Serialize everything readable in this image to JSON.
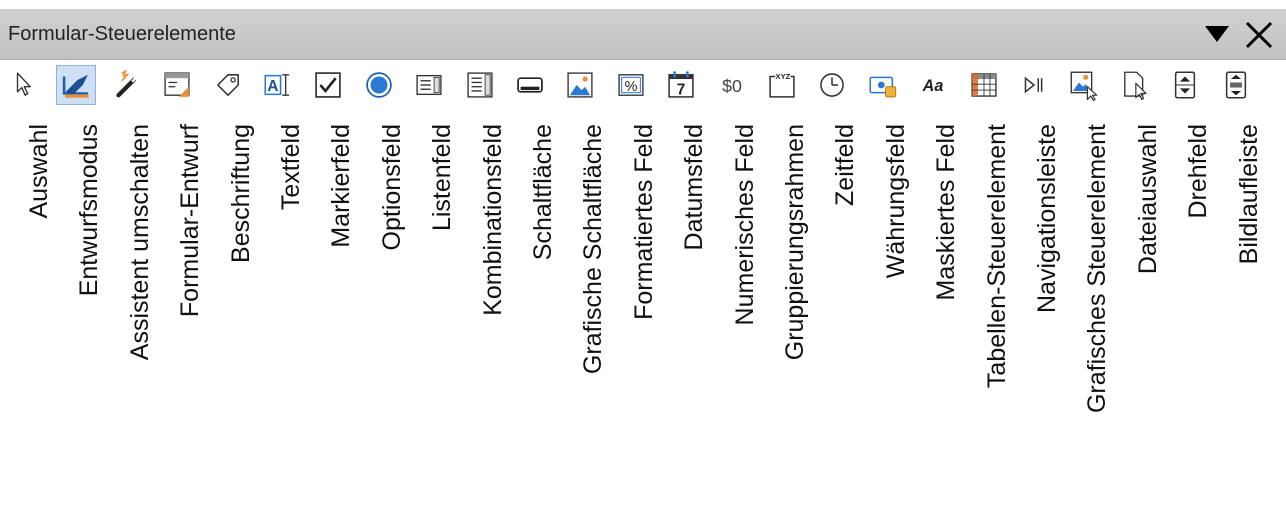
{
  "window": {
    "title": "Formular-Steuerelemente"
  },
  "controls": [
    {
      "id": "auswahl",
      "label": "Auswahl",
      "icon": "pointer-icon"
    },
    {
      "id": "entwurfsmodus",
      "label": "Entwurfsmodus",
      "icon": "design-mode-icon",
      "active": true
    },
    {
      "id": "assistent",
      "label": "Assistent umschalten",
      "icon": "wizard-icon"
    },
    {
      "id": "formular-entwurf",
      "label": "Formular-Entwurf",
      "icon": "form-design-icon"
    },
    {
      "id": "beschriftung",
      "label": "Beschriftung",
      "icon": "label-tag-icon"
    },
    {
      "id": "textfeld",
      "label": "Textfeld",
      "icon": "text-box-icon",
      "icon_text": "A"
    },
    {
      "id": "markierfeld",
      "label": "Markierfeld",
      "icon": "checkbox-icon"
    },
    {
      "id": "optionsfeld",
      "label": "Optionsfeld",
      "icon": "option-button-icon"
    },
    {
      "id": "listenfeld",
      "label": "Listenfeld",
      "icon": "list-box-icon"
    },
    {
      "id": "kombinationsfeld",
      "label": "Kombinationsfeld",
      "icon": "combo-box-icon"
    },
    {
      "id": "schaltflaeche",
      "label": "Schaltfläche",
      "icon": "push-button-icon"
    },
    {
      "id": "grafische-schaltflaeche",
      "label": "Grafische Schaltfläche",
      "icon": "image-button-icon"
    },
    {
      "id": "formatiertes-feld",
      "label": "Formatiertes Feld",
      "icon": "formatted-field-icon",
      "icon_text": "%"
    },
    {
      "id": "datumsfeld",
      "label": "Datumsfeld",
      "icon": "date-field-icon",
      "icon_text": "7"
    },
    {
      "id": "numerisches-feld",
      "label": "Numerisches Feld",
      "icon": "numeric-field-icon",
      "icon_text": "$0"
    },
    {
      "id": "gruppierungsrahmen",
      "label": "Gruppierungsrahmen",
      "icon": "group-box-icon",
      "icon_text": "XYZ"
    },
    {
      "id": "zeitfeld",
      "label": "Zeitfeld",
      "icon": "time-field-icon"
    },
    {
      "id": "waehrungsfeld",
      "label": "Währungsfeld",
      "icon": "currency-field-icon"
    },
    {
      "id": "maskiertes-feld",
      "label": "Maskiertes Feld",
      "icon": "pattern-field-icon",
      "icon_text": "Aa"
    },
    {
      "id": "tabellen-steuerelement",
      "label": "Tabellen-Steuerelement",
      "icon": "table-control-icon"
    },
    {
      "id": "navigationsleiste",
      "label": "Navigationsleiste",
      "icon": "navigation-bar-icon"
    },
    {
      "id": "grafisches-steuerelement",
      "label": "Grafisches Steuerelement",
      "icon": "image-control-icon"
    },
    {
      "id": "dateiauswahl",
      "label": "Dateiauswahl",
      "icon": "file-selection-icon"
    },
    {
      "id": "drehfeld",
      "label": "Drehfeld",
      "icon": "spin-button-icon"
    },
    {
      "id": "bildlaufleiste",
      "label": "Bildlaufleiste",
      "icon": "scrollbar-icon"
    }
  ],
  "colors": {
    "titlebar": "#c9c9c9",
    "accent": "#2a79d2",
    "active_bg": "#cfe0f6",
    "orange": "#e8913a"
  }
}
